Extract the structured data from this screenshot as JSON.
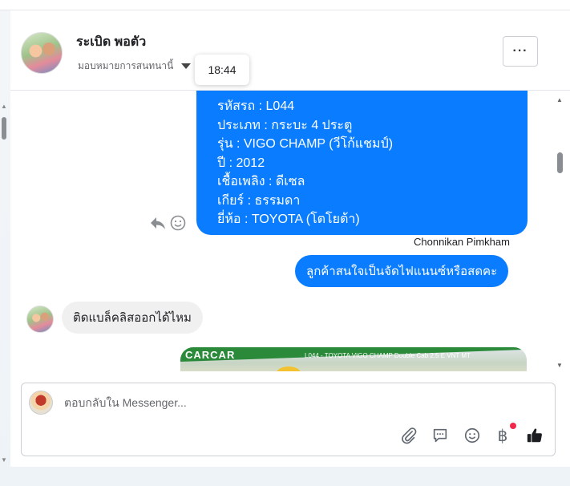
{
  "header": {
    "contact_name": "ระเบิด พอตัว",
    "subtitle": "มอบหมายการสนทนานี้",
    "timestamp_tooltip": "18:44",
    "more_button_label": "···"
  },
  "messages": {
    "vehicle_card": {
      "lines": [
        "รหัสรถ : L044",
        "ประเภท : กระบะ 4 ประตู",
        "รุ่น : VIGO CHAMP (วีโก้แชมป์)",
        "ปี : 2012",
        "เชื้อเพลิง : ดีเซล",
        "เกียร์ : ธรรมดา",
        "ยี่ห้อ : TOYOTA (โตโยต้า)"
      ]
    },
    "sender_name": "Chonnikan Pimkham",
    "outgoing_question": "ลูกค้าสนใจเป็นจัดไฟแนนซ์หรือสดคะ",
    "incoming_reply": "ติดแบล็คลิสออกได้ไหม",
    "image_preview": {
      "banner_text": "L044 - TOYOTA VIGO CHAMP Double Cab 2.5 E VNT MT",
      "logo_text": "CARCAR"
    }
  },
  "composer": {
    "placeholder": "ตอบกลับใน Messenger..."
  },
  "icons": {
    "attach": "paperclip-icon",
    "saved_replies": "chat-bubble-icon",
    "emoji": "smiley-icon",
    "payment": "baht-icon",
    "like": "thumbs-up-icon"
  },
  "colors": {
    "outgoing_bubble": "#0a7cff",
    "incoming_bubble": "#f0f0f0",
    "notification_dot": "#f02849"
  }
}
